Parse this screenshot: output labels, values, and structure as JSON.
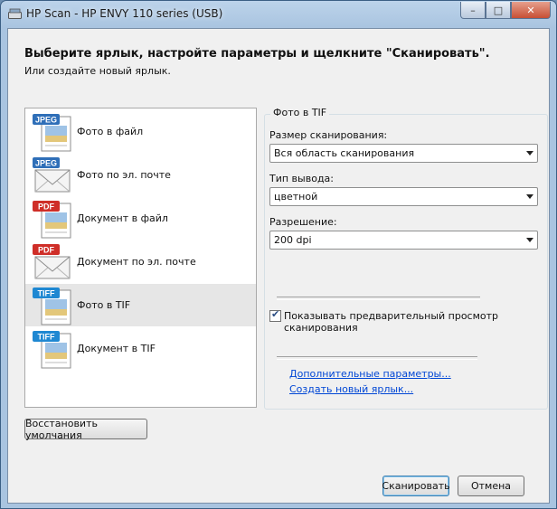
{
  "window": {
    "title": "HP Scan - HP ENVY 110 series (USB)"
  },
  "header": {
    "instruction": "Выберите ярлык, настройте параметры и щелкните \"Сканировать\".",
    "sub": "Или создайте новый ярлык."
  },
  "shortcuts": [
    {
      "label": "Фото в файл",
      "badge": "JPEG",
      "badge_color": "#2f6fb8",
      "kind": "file"
    },
    {
      "label": "Фото по эл. почте",
      "badge": "JPEG",
      "badge_color": "#2f6fb8",
      "kind": "email"
    },
    {
      "label": "Документ в файл",
      "badge": "PDF",
      "badge_color": "#cf2e28",
      "kind": "file"
    },
    {
      "label": "Документ по эл. почте",
      "badge": "PDF",
      "badge_color": "#cf2e28",
      "kind": "email"
    },
    {
      "label": "Фото в TIF",
      "badge": "TIFF",
      "badge_color": "#1f88d2",
      "kind": "file",
      "selected": true
    },
    {
      "label": "Документ в TIF",
      "badge": "TIFF",
      "badge_color": "#1f88d2",
      "kind": "file"
    }
  ],
  "settings": {
    "group_title": "Фото в TIF",
    "scan_size_label": "Размер сканирования:",
    "scan_size_value": "Вся область сканирования",
    "output_type_label": "Тип вывода:",
    "output_type_value": "цветной",
    "resolution_label": "Разрешение:",
    "resolution_value": "200 dpi",
    "preview_label": "Показывать предварительный просмотр сканирования",
    "preview_checked": true,
    "more_options_link": "Дополнительные параметры...",
    "new_shortcut_link": "Создать новый ярлык..."
  },
  "buttons": {
    "restore": "Восстановить умолчания",
    "scan": "Сканировать",
    "cancel": "Отмена"
  }
}
